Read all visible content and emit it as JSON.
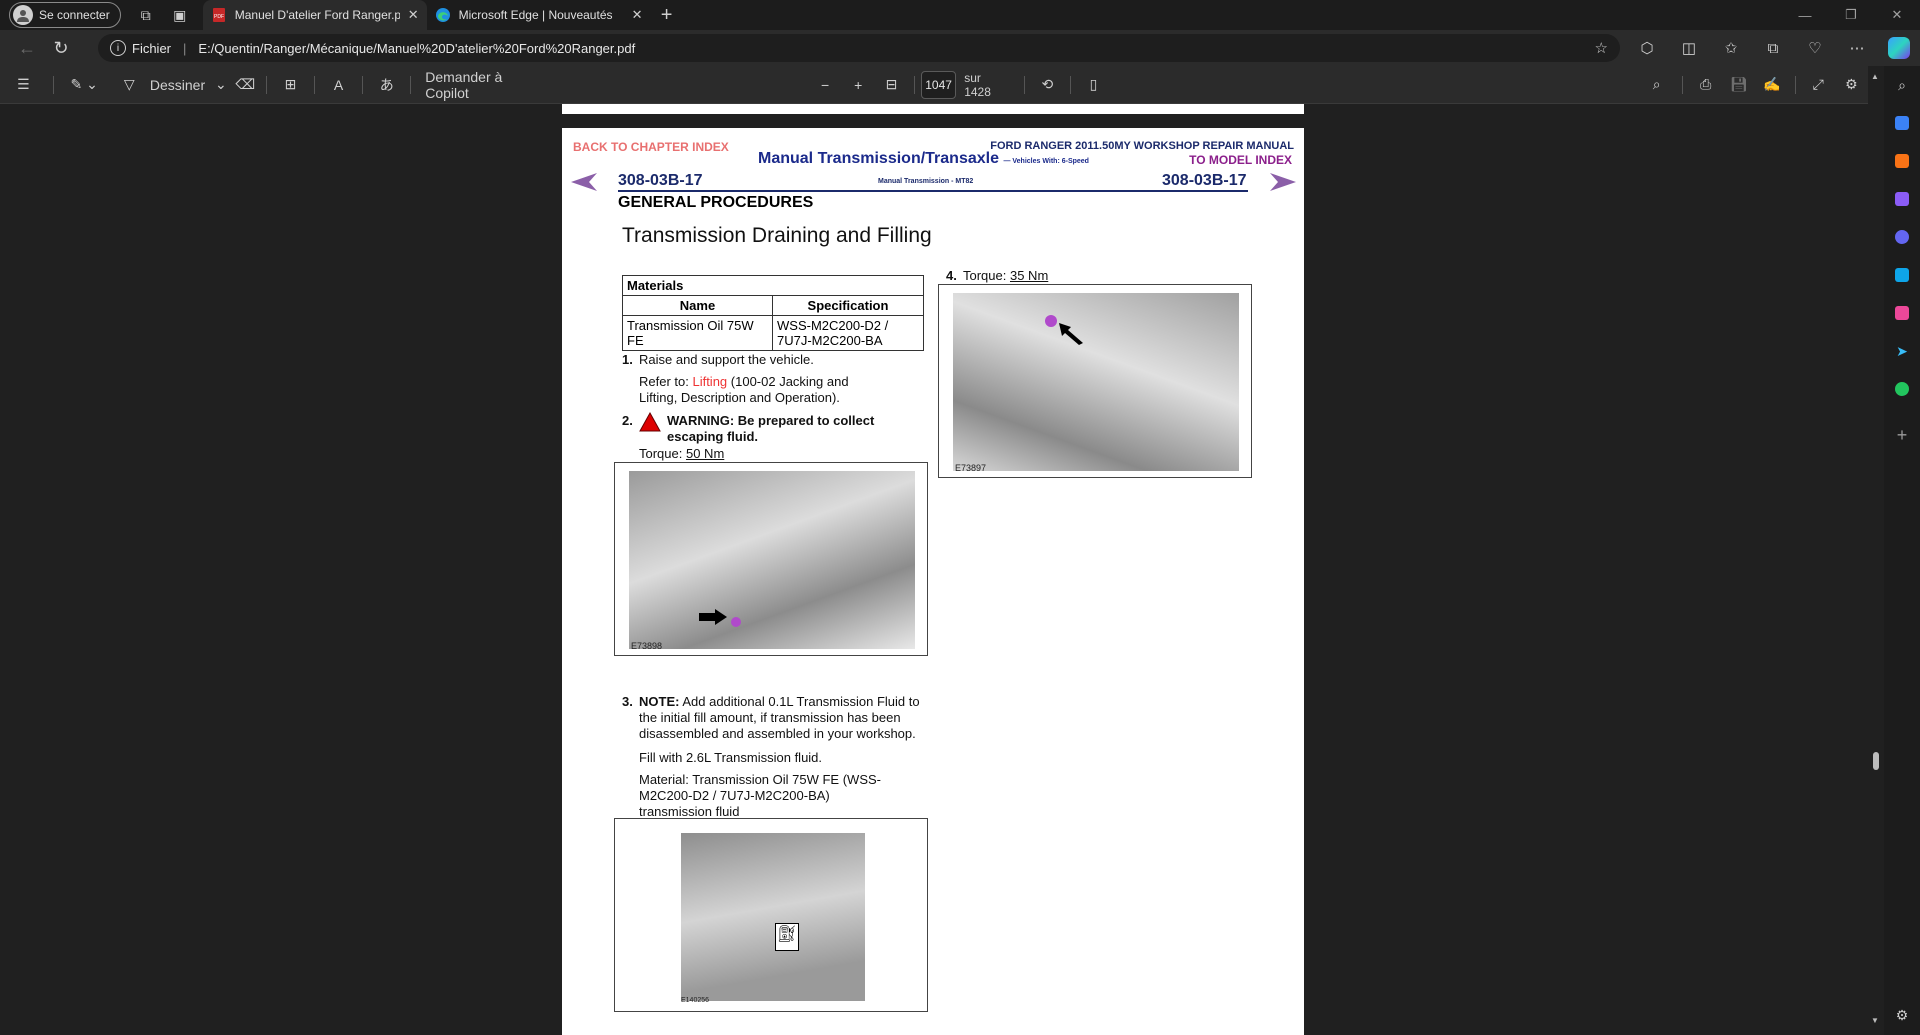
{
  "browser": {
    "profile_label": "Se connecter",
    "tabs": [
      {
        "title": "Manuel D'atelier Ford Ranger.pdf",
        "active": true
      },
      {
        "title": "Microsoft Edge | Nouveautés",
        "active": false
      }
    ],
    "address_label": "Fichier",
    "url": "E:/Quentin/Ranger/Mécanique/Manuel%20D'atelier%20Ford%20Ranger.pdf"
  },
  "pdf_toolbar": {
    "draw_label": "Dessiner",
    "copilot_label": "Demander à Copilot",
    "page_current": "1047",
    "page_total": "sur 1428"
  },
  "page": {
    "back_link": "BACK TO CHAPTER INDEX",
    "manual_title": "FORD RANGER 2011.50MY WORKSHOP REPAIR MANUAL",
    "model_link": "TO MODEL INDEX",
    "section_title": "Manual Transmission/Transaxle",
    "section_subtitle": "— Vehicles With: 6-Speed",
    "page_code_left": "308-03B-17",
    "page_code_right": "308-03B-17",
    "middle_label": "Manual Transmission - MT82",
    "heading": "GENERAL PROCEDURES",
    "title": "Transmission Draining and Filling",
    "materials": {
      "caption": "Materials",
      "col_name": "Name",
      "col_spec": "Specification",
      "row_name": "Transmission Oil 75W FE",
      "row_spec": "WSS-M2C200-D2 / 7U7J-M2C200-BA"
    },
    "step1_num": "1.",
    "step1": "Raise and support the vehicle.",
    "step1_ref_prefix": "Refer to: ",
    "step1_ref_link": "Lifting",
    "step1_ref_rest": " (100-02 Jacking and Lifting, Description and Operation).",
    "step2_num": "2.",
    "step2_warning": "WARNING: Be prepared to collect escaping fluid.",
    "step2_torque_label": "Torque: ",
    "step2_torque": "50 Nm",
    "fig1_caption": "E73898",
    "step3_num": "3.",
    "step3_note_label": "NOTE:",
    "step3_note": " Add additional 0.1L Transmission Fluid to the initial fill amount, if transmission has been disassembled and assembled in your workshop.",
    "step3_fill": "Fill with 2.6L Transmission fluid.",
    "step3_material": "Material: Transmission Oil 75W FE (WSS-M2C200-D2 / 7U7J-M2C200-BA) transmission fluid",
    "fig3_caption": "E140256",
    "step4_num": "4.",
    "step4_torque_label": "Torque: ",
    "step4_torque": "35 Nm",
    "fig2_caption": "E73897"
  }
}
